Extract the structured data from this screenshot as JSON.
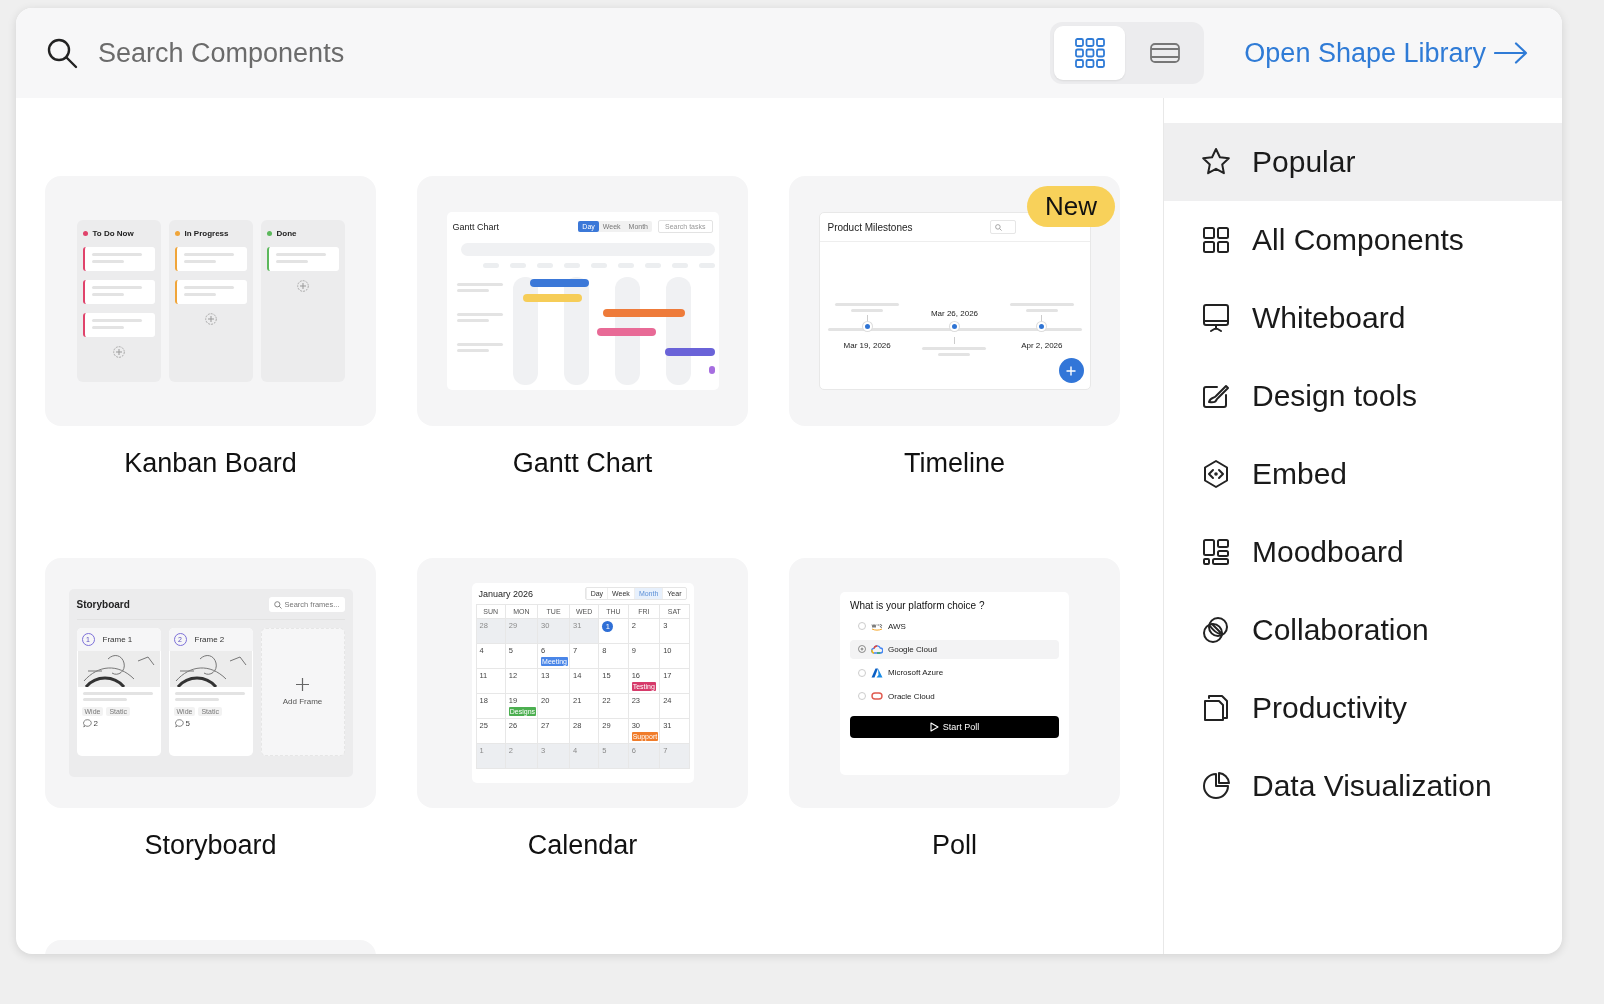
{
  "search": {
    "placeholder": "Search Components"
  },
  "view_toggle": [
    {
      "kind": "grid",
      "selected": true
    },
    {
      "kind": "list",
      "selected": false
    }
  ],
  "library_link": {
    "label": "Open Shape Library"
  },
  "components": [
    {
      "kind": "kanban",
      "title": "Kanban Board",
      "preview": {
        "columns": [
          {
            "title": "To Do Now",
            "color": "#e0436b"
          },
          {
            "title": "In Progress",
            "color": "#f0a53a"
          },
          {
            "title": "Done",
            "color": "#5cb85c"
          }
        ]
      }
    },
    {
      "kind": "gantt",
      "title": "Gantt Chart",
      "preview": {
        "title": "Gantt Chart",
        "tabs": [
          {
            "label": "Day",
            "selected": true
          },
          {
            "label": "Week",
            "selected": false
          },
          {
            "label": "Month",
            "selected": false
          }
        ],
        "search_placeholder": "Search tasks"
      }
    },
    {
      "kind": "timeline",
      "title": "Timeline",
      "badge": "New",
      "preview": {
        "title": "Product Milestones",
        "milestones": [
          {
            "date": "Mar 19, 2026"
          },
          {
            "date": "Mar 26, 2026"
          },
          {
            "date": "Apr 2, 2026"
          }
        ]
      }
    },
    {
      "kind": "storyboard",
      "title": "Storyboard",
      "preview": {
        "title": "Storyboard",
        "search_placeholder": "Search frames...",
        "frames": [
          {
            "number": "1",
            "title": "Frame 1",
            "tags": [
              "Wide",
              "Static"
            ],
            "comments": "2"
          },
          {
            "number": "2",
            "title": "Frame 2",
            "tags": [
              "Wide",
              "Static"
            ],
            "comments": "5"
          }
        ],
        "add_label": "Add Frame"
      }
    },
    {
      "kind": "calendar",
      "title": "Calendar",
      "preview": {
        "title": "January 2026",
        "views": [
          {
            "label": "Day",
            "selected": false
          },
          {
            "label": "Week",
            "selected": false
          },
          {
            "label": "Month",
            "selected": true
          },
          {
            "label": "Year",
            "selected": false
          }
        ],
        "weekdays": [
          "SUN",
          "MON",
          "TUE",
          "WED",
          "THU",
          "FRI",
          "SAT"
        ],
        "weeks": [
          {
            "days": [
              {
                "day": "28",
                "outside": true,
                "today": false
              },
              {
                "day": "29",
                "outside": true,
                "today": false
              },
              {
                "day": "30",
                "outside": true,
                "today": false
              },
              {
                "day": "31",
                "outside": true,
                "today": false
              },
              {
                "day": "1",
                "outside": false,
                "today": true
              },
              {
                "day": "2",
                "outside": false,
                "today": false
              },
              {
                "day": "3",
                "outside": false,
                "today": false
              }
            ]
          },
          {
            "days": [
              {
                "day": "4",
                "outside": false,
                "today": false
              },
              {
                "day": "5",
                "outside": false,
                "today": false
              },
              {
                "day": "6",
                "outside": false,
                "today": false,
                "event": {
                  "label": "Meeting",
                  "color": "#4a86e8"
                }
              },
              {
                "day": "7",
                "outside": false,
                "today": false
              },
              {
                "day": "8",
                "outside": false,
                "today": false
              },
              {
                "day": "9",
                "outside": false,
                "today": false
              },
              {
                "day": "10",
                "outside": false,
                "today": false
              }
            ]
          },
          {
            "days": [
              {
                "day": "11",
                "outside": false,
                "today": false
              },
              {
                "day": "12",
                "outside": false,
                "today": false
              },
              {
                "day": "13",
                "outside": false,
                "today": false
              },
              {
                "day": "14",
                "outside": false,
                "today": false
              },
              {
                "day": "15",
                "outside": false,
                "today": false
              },
              {
                "day": "16",
                "outside": false,
                "today": false,
                "event": {
                  "label": "Testing",
                  "color": "#d63a6a"
                }
              },
              {
                "day": "17",
                "outside": false,
                "today": false
              }
            ]
          },
          {
            "days": [
              {
                "day": "18",
                "outside": false,
                "today": false
              },
              {
                "day": "19",
                "outside": false,
                "today": false,
                "event": {
                  "label": "Designs",
                  "color": "#4caf50"
                }
              },
              {
                "day": "20",
                "outside": false,
                "today": false
              },
              {
                "day": "21",
                "outside": false,
                "today": false
              },
              {
                "day": "22",
                "outside": false,
                "today": false
              },
              {
                "day": "23",
                "outside": false,
                "today": false
              },
              {
                "day": "24",
                "outside": false,
                "today": false
              }
            ]
          },
          {
            "days": [
              {
                "day": "25",
                "outside": false,
                "today": false
              },
              {
                "day": "26",
                "outside": false,
                "today": false
              },
              {
                "day": "27",
                "outside": false,
                "today": false
              },
              {
                "day": "28",
                "outside": false,
                "today": false
              },
              {
                "day": "29",
                "outside": false,
                "today": false
              },
              {
                "day": "30",
                "outside": false,
                "today": false,
                "event": {
                  "label": "Support",
                  "color": "#f07c2a"
                }
              },
              {
                "day": "31",
                "outside": false,
                "today": false
              }
            ]
          },
          {
            "days": [
              {
                "day": "1",
                "outside": true,
                "today": false
              },
              {
                "day": "2",
                "outside": true,
                "today": false
              },
              {
                "day": "3",
                "outside": true,
                "today": false
              },
              {
                "day": "4",
                "outside": true,
                "today": false
              },
              {
                "day": "5",
                "outside": true,
                "today": false
              },
              {
                "day": "6",
                "outside": true,
                "today": false
              },
              {
                "day": "7",
                "outside": true,
                "today": false
              }
            ]
          }
        ]
      }
    },
    {
      "kind": "poll",
      "title": "Poll",
      "preview": {
        "question": "What is your platform choice ?",
        "options": [
          {
            "label": "AWS",
            "selected": false
          },
          {
            "label": "Google Cloud",
            "selected": true
          },
          {
            "label": "Microsoft Azure",
            "selected": false
          },
          {
            "label": "Oracle Cloud",
            "selected": false
          }
        ],
        "button": "Start Poll"
      }
    },
    {
      "kind": "blank"
    }
  ],
  "sidebar": {
    "items": [
      {
        "label": "Popular",
        "selected": true
      },
      {
        "label": "All Components",
        "selected": false
      },
      {
        "label": "Whiteboard",
        "selected": false
      },
      {
        "label": "Design tools",
        "selected": false
      },
      {
        "label": "Embed",
        "selected": false
      },
      {
        "label": "Moodboard",
        "selected": false
      },
      {
        "label": "Collaboration",
        "selected": false
      },
      {
        "label": "Productivity",
        "selected": false
      },
      {
        "label": "Data Visualization",
        "selected": false
      }
    ]
  }
}
